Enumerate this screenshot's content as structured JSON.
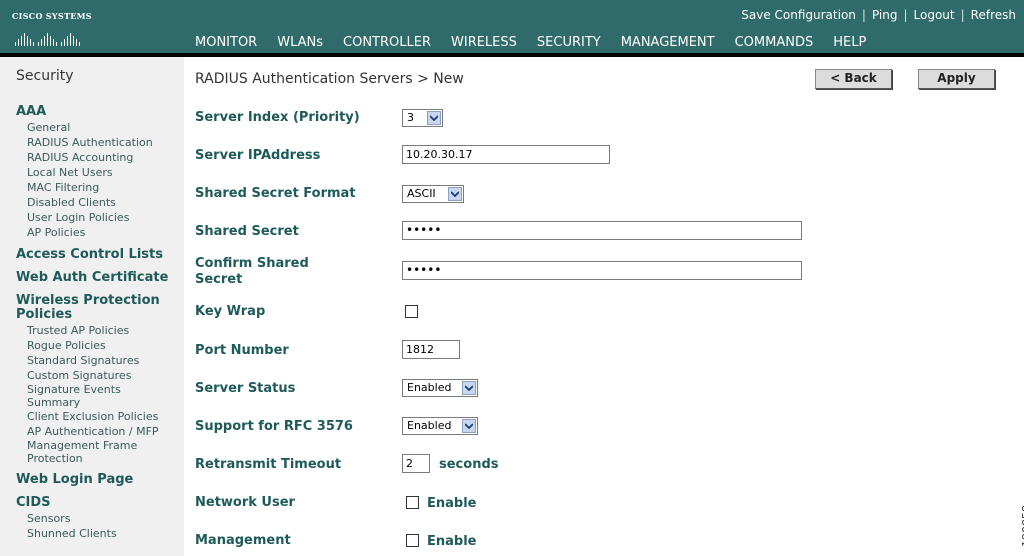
{
  "header": {
    "brand": "Cisco Systems",
    "links": [
      "Save Configuration",
      "Ping",
      "Logout",
      "Refresh"
    ],
    "nav": [
      "MONITOR",
      "WLANs",
      "CONTROLLER",
      "WIRELESS",
      "SECURITY",
      "MANAGEMENT",
      "COMMANDS",
      "HELP"
    ],
    "active_nav": "SECURITY",
    "accent_color": "#f79a1e",
    "bar_color": "#2f6b6b"
  },
  "sidebar": {
    "title": "Security",
    "sections": [
      {
        "label": "AAA",
        "items": [
          "General",
          "RADIUS Authentication",
          "RADIUS Accounting",
          "Local Net Users",
          "MAC Filtering",
          "Disabled Clients",
          "User Login Policies",
          "AP Policies"
        ]
      },
      {
        "label": "Access Control Lists",
        "items": []
      },
      {
        "label": "Web Auth Certificate",
        "items": []
      },
      {
        "label": "Wireless Protection Policies",
        "items": [
          "Trusted AP Policies",
          "Rogue Policies",
          "Standard Signatures",
          "Custom Signatures",
          "Signature Events Summary",
          "Client Exclusion Policies",
          "AP Authentication / MFP",
          "Management Frame Protection"
        ]
      },
      {
        "label": "Web Login Page",
        "items": []
      },
      {
        "label": "CIDS",
        "items": [
          "Sensors",
          "Shunned Clients"
        ]
      }
    ]
  },
  "main": {
    "title": "RADIUS Authentication Servers > New",
    "back_label": "< Back",
    "apply_label": "Apply",
    "fields": {
      "server_index": {
        "label": "Server Index (Priority)",
        "value": "3"
      },
      "server_ip": {
        "label": "Server IPAddress",
        "value": "10.20.30.17"
      },
      "secret_format": {
        "label": "Shared Secret Format",
        "value": "ASCII"
      },
      "shared_secret": {
        "label": "Shared Secret",
        "value": "•••••"
      },
      "confirm_secret": {
        "label": "Confirm Shared Secret",
        "value": "•••••"
      },
      "key_wrap": {
        "label": "Key Wrap",
        "checked": false
      },
      "port": {
        "label": "Port Number",
        "value": "1812"
      },
      "server_status": {
        "label": "Server Status",
        "value": "Enabled"
      },
      "rfc3576": {
        "label": "Support for RFC 3576",
        "value": "Enabled"
      },
      "retransmit": {
        "label": "Retransmit Timeout",
        "value": "2",
        "unit": "seconds"
      },
      "network_user": {
        "label": "Network User",
        "option": "Enable",
        "checked": false
      },
      "management": {
        "label": "Management",
        "option": "Enable",
        "checked": false
      }
    }
  },
  "figure_id": "190858"
}
